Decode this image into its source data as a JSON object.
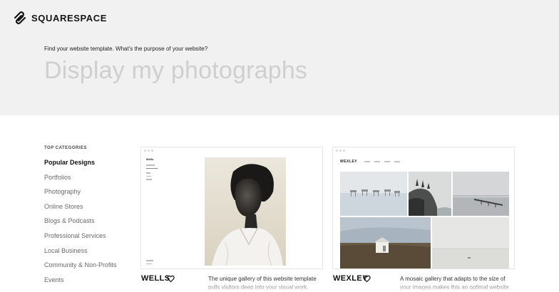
{
  "brand": {
    "name": "SQUARESPACE",
    "icon": "squarespace-logo-icon"
  },
  "hero": {
    "prompt": "Find your website template. What's the purpose of your website?",
    "purpose_value": "Display my photographs"
  },
  "sidebar": {
    "heading": "TOP CATEGORIES",
    "items": [
      {
        "label": "Popular Designs",
        "active": true
      },
      {
        "label": "Portfolios"
      },
      {
        "label": "Photography"
      },
      {
        "label": "Online Stores"
      },
      {
        "label": "Blogs & Podcasts"
      },
      {
        "label": "Professional Services"
      },
      {
        "label": "Local Business"
      },
      {
        "label": "Community & Non-Profits"
      },
      {
        "label": "Events"
      }
    ]
  },
  "templates": [
    {
      "name": "WELLS",
      "preview_brand": "Wells",
      "description": "The unique gallery of this website template pulls visitors deep into your visual work.",
      "favorite_icon": "heart-icon"
    },
    {
      "name": "WEXLEY",
      "preview_brand": "WEXLEY",
      "description": "A mosaic gallery that adapts to the size of your images makes this an optimal website",
      "favorite_icon": "heart-icon"
    }
  ],
  "colors": {
    "hero_bg": "#f1f1f1",
    "purpose_text": "#cfcfcf",
    "active_category": "#111111",
    "inactive_category": "#6a6a6a"
  }
}
